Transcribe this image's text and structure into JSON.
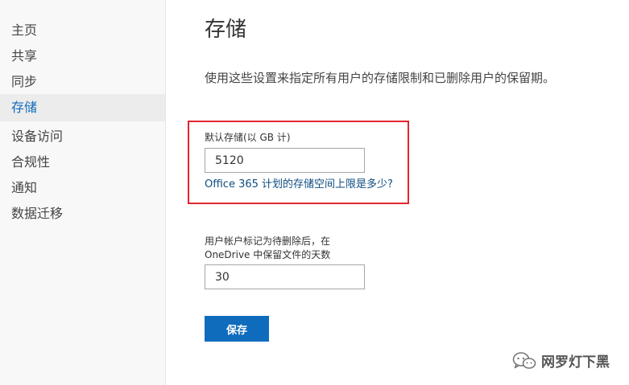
{
  "sidebar": {
    "items": [
      {
        "label": "主页",
        "active": false
      },
      {
        "label": "共享",
        "active": false
      },
      {
        "label": "同步",
        "active": false
      },
      {
        "label": "存储",
        "active": true
      },
      {
        "label": "设备访问",
        "active": false
      },
      {
        "label": "合规性",
        "active": false
      },
      {
        "label": "通知",
        "active": false
      },
      {
        "label": "数据迁移",
        "active": false
      }
    ]
  },
  "main": {
    "title": "存储",
    "description": "使用这些设置来指定所有用户的存储限制和已删除用户的保留期。",
    "default_storage": {
      "label": "默认存储(以 GB 计)",
      "value": "5120",
      "help_link": "Office 365 计划的存储空间上限是多少?"
    },
    "retention": {
      "label_line1": "用户帐户标记为待删除后，在",
      "label_line2": "OneDrive 中保留文件的天数",
      "value": "30"
    },
    "save_label": "保存"
  },
  "watermark": {
    "text": "网罗灯下黑",
    "icon": "wechat-icon"
  },
  "colors": {
    "accent": "#0f6cbd",
    "highlight_border": "#e3262e",
    "sidebar_bg": "#f8f8f8",
    "active_bg": "#ececec"
  }
}
